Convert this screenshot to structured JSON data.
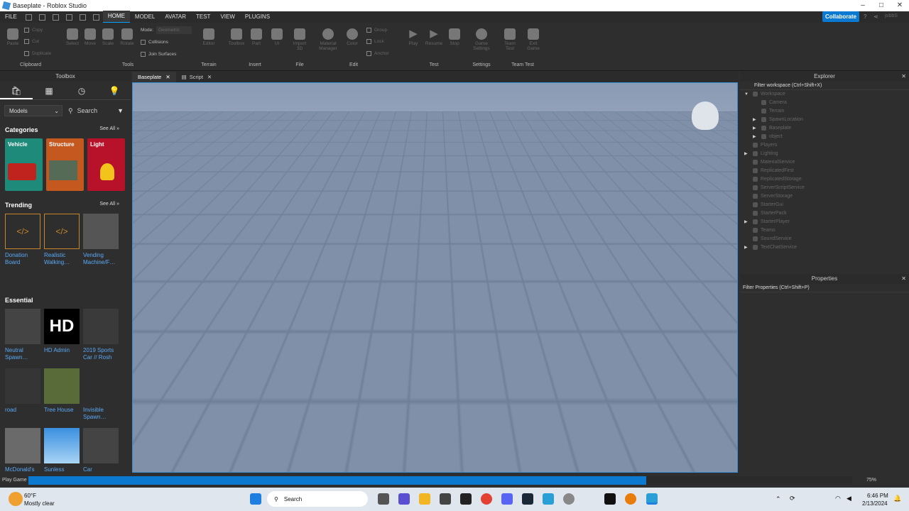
{
  "window": {
    "title": "Baseplate - Roblox Studio"
  },
  "menu": {
    "file": "FILE",
    "home": "HOME",
    "model": "MODEL",
    "avatar": "AVATAR",
    "test": "TEST",
    "view": "VIEW",
    "plugins": "PLUGINS",
    "collaborate": "Collaborate",
    "user": "jobbS"
  },
  "ribbon": {
    "clipboard": {
      "label": "Clipboard",
      "paste": "Paste",
      "copy": "Copy",
      "cut": "Cut",
      "duplicate": "Duplicate"
    },
    "tools": {
      "label": "Tools",
      "select": "Select",
      "move": "Move",
      "scale": "Scale",
      "rotate": "Rotate",
      "mode_label": "Mode:",
      "mode_value": "Geometric",
      "collisions": "Collisions",
      "join": "Join Surfaces"
    },
    "terrain": {
      "label": "Terrain",
      "editor": "Editor"
    },
    "insert": {
      "label": "Insert",
      "toolbox": "Toolbox",
      "part": "Part",
      "ui": "UI"
    },
    "file": {
      "label": "File",
      "import": "Import 3D"
    },
    "edit": {
      "label": "Edit",
      "material": "Material Manager",
      "color": "Color",
      "group": "Group",
      "lock": "Lock",
      "anchor": "Anchor"
    },
    "test": {
      "label": "Test",
      "play": "Play",
      "resume": "Resume",
      "stop": "Stop"
    },
    "settings": {
      "label": "Settings",
      "game": "Game Settings"
    },
    "team": {
      "label": "Team Test",
      "team": "Team Test",
      "exit": "Exit Game"
    }
  },
  "toolbox": {
    "title": "Toolbox",
    "dropdown": "Models",
    "search_placeholder": "Search",
    "categories_title": "Categories",
    "see_all": "See All »",
    "categories": [
      {
        "label": "Vehicle",
        "color": "#1e8a7a"
      },
      {
        "label": "Structure",
        "color": "#c4581e"
      },
      {
        "label": "Light",
        "color": "#b8112a"
      }
    ],
    "trending_title": "Trending",
    "trending": [
      {
        "name": "Donation Board"
      },
      {
        "name": "Realistic Walking…"
      },
      {
        "name": "Vending Machine/F…"
      }
    ],
    "essential_title": "Essential",
    "essential": [
      {
        "name": "Neutral Spawn…"
      },
      {
        "name": "HD Admin",
        "tile": "HD"
      },
      {
        "name": "2019 Sports Car // Rosh"
      },
      {
        "name": "road"
      },
      {
        "name": "Tree House"
      },
      {
        "name": "Invisible Spawn…"
      },
      {
        "name": "McDonald's"
      },
      {
        "name": "Sunless"
      },
      {
        "name": "Car"
      }
    ]
  },
  "editor_tabs": [
    {
      "label": "Baseplate"
    },
    {
      "label": "Script"
    }
  ],
  "explorer": {
    "title": "Explorer",
    "filter": "Filter workspace (Ctrl+Shift+X)",
    "items": [
      "Workspace",
      "Camera",
      "Terrain",
      "SpawnLocation",
      "Baseplate",
      "object",
      "Players",
      "Lighting",
      "MaterialService",
      "ReplicatedFirst",
      "ReplicatedStorage",
      "ServerScriptService",
      "ServerStorage",
      "StarterGui",
      "StarterPack",
      "StarterPlayer",
      "Teams",
      "SoundService",
      "TextChatService"
    ]
  },
  "properties": {
    "title": "Properties",
    "filter": "Filter Properties (Ctrl+Shift+P)"
  },
  "status": {
    "label": "Play Game",
    "progress_pct": 75,
    "progress_text": "75%"
  },
  "taskbar": {
    "temp": "60°F",
    "weather": "Mostly clear",
    "search": "Search",
    "time": "6:46 PM",
    "date": "2/13/2024"
  }
}
